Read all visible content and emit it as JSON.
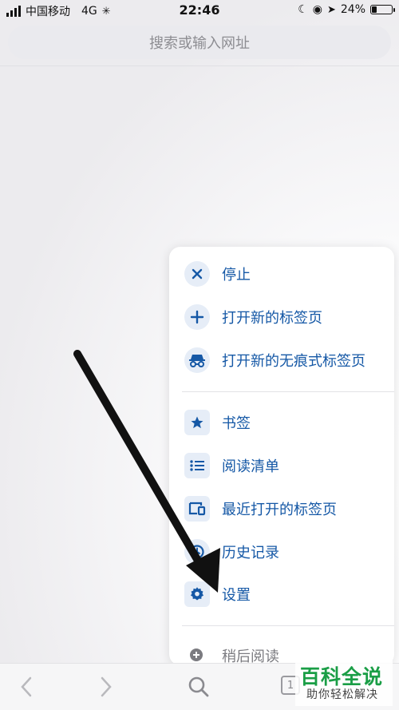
{
  "status_bar": {
    "carrier": "中国移动",
    "network": "4G",
    "time": "22:46",
    "battery_percent": "24%",
    "battery_level": 0.24
  },
  "search": {
    "placeholder": "搜索或输入网址"
  },
  "menu": {
    "items": [
      {
        "label": "停止",
        "icon": "close-icon"
      },
      {
        "label": "打开新的标签页",
        "icon": "plus-icon"
      },
      {
        "label": "打开新的无痕式标签页",
        "icon": "incognito-icon"
      },
      {
        "label": "书签",
        "icon": "star-icon"
      },
      {
        "label": "阅读清单",
        "icon": "list-icon"
      },
      {
        "label": "最近打开的标签页",
        "icon": "devices-icon"
      },
      {
        "label": "历史记录",
        "icon": "history-icon"
      },
      {
        "label": "设置",
        "icon": "gear-icon"
      },
      {
        "label": "稍后阅读",
        "icon": "add-circle-icon"
      }
    ]
  },
  "toolbar": {
    "tab_count": "1"
  },
  "watermark": {
    "title": "百科全说",
    "subtitle": "助你轻松解决"
  },
  "colors": {
    "accent": "#1558a6",
    "icon_bg": "#e6edf7",
    "watermark_green": "#1a9e46"
  }
}
